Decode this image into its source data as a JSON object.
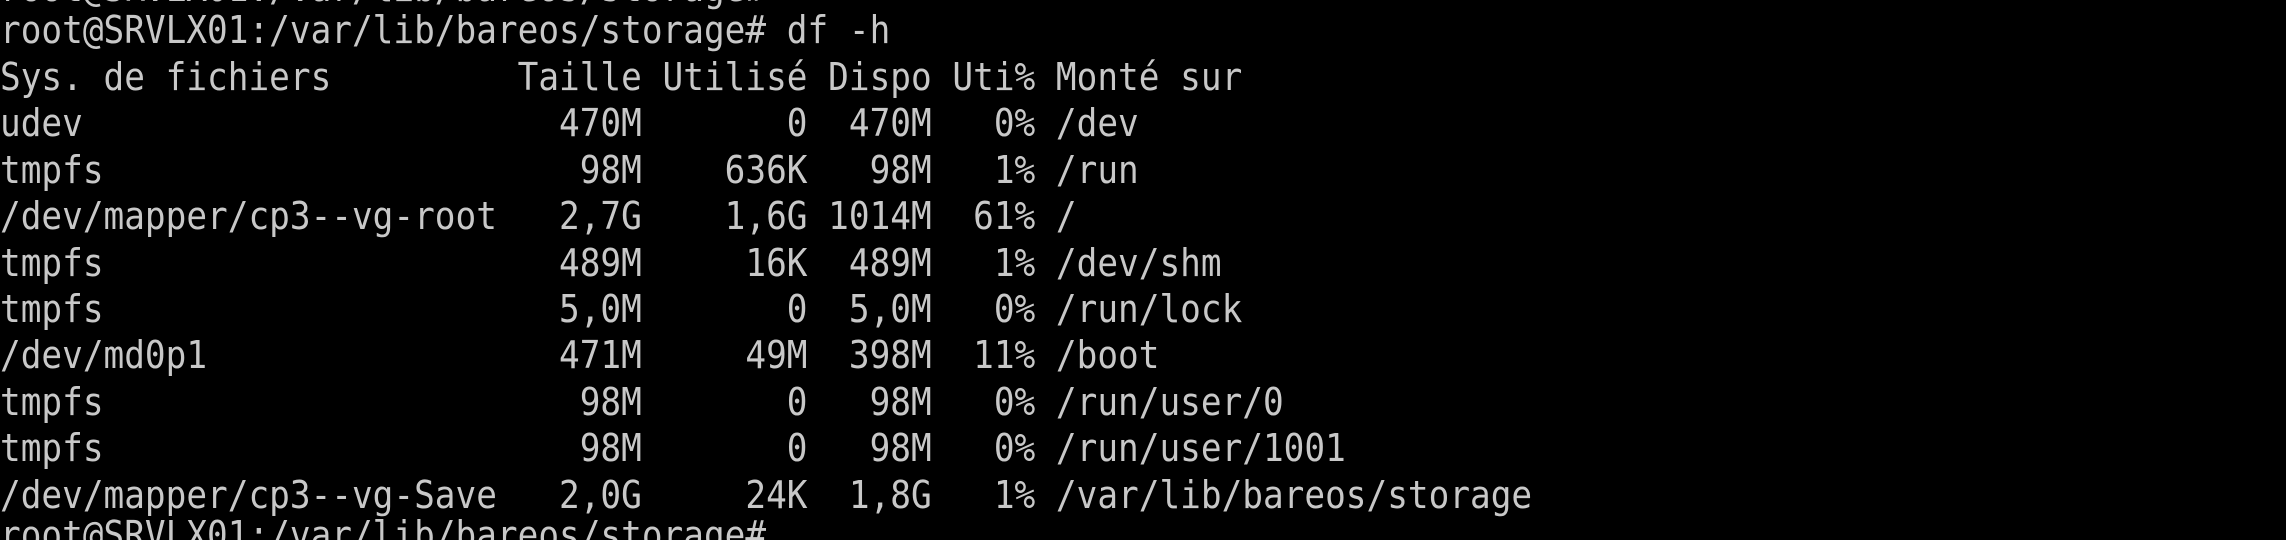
{
  "terminal": {
    "prompt_partial_top": "root@SRVLX01:/var/lib/bareos/storage#",
    "command_line": "root@SRVLX01:/var/lib/bareos/storage# df -h",
    "header": "Sys. de fichiers         Taille Utilisé Dispo Uti% Monté sur",
    "rows": [
      "udev                       470M       0  470M   0% /dev",
      "tmpfs                       98M    636K   98M   1% /run",
      "/dev/mapper/cp3--vg-root   2,7G    1,6G 1014M  61% /",
      "tmpfs                      489M     16K  489M   1% /dev/shm",
      "tmpfs                      5,0M       0  5,0M   0% /run/lock",
      "/dev/md0p1                 471M     49M  398M  11% /boot",
      "tmpfs                       98M       0   98M   0% /run/user/0",
      "tmpfs                       98M       0   98M   0% /run/user/1001",
      "/dev/mapper/cp3--vg-Save   2,0G     24K  1,8G   1% /var/lib/bareos/storage"
    ],
    "prompt_partial_bottom": "root@SRVLX01:/var/lib/bareos/storage#"
  }
}
